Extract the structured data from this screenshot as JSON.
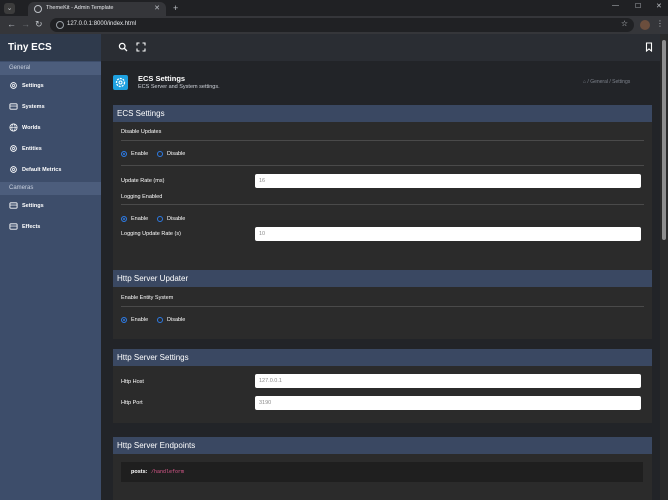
{
  "browser": {
    "tab_title": "ThemeKit - Admin Template",
    "url": "127.0.0.1:8000/index.html"
  },
  "sidebar": {
    "brand": "Tiny ECS",
    "sections": [
      {
        "label": "General"
      },
      {
        "label": "Cameras"
      }
    ],
    "general_items": [
      {
        "label": "Settings",
        "icon": "gear-icon"
      },
      {
        "label": "Systems",
        "icon": "monitor-icon"
      },
      {
        "label": "Worlds",
        "icon": "globe-icon"
      },
      {
        "label": "Entities",
        "icon": "gear-icon"
      },
      {
        "label": "Default Metrics",
        "icon": "gear-icon"
      }
    ],
    "camera_items": [
      {
        "label": "Settings",
        "icon": "monitor-icon"
      },
      {
        "label": "Effects",
        "icon": "monitor-icon"
      }
    ]
  },
  "header": {
    "title": "ECS Settings",
    "subtitle": "ECS Server and System settings.",
    "breadcrumb": [
      "General",
      "Settings"
    ]
  },
  "cards": {
    "ecs": {
      "title": "ECS Settings",
      "disable_updates_label": "Disable Updates",
      "enable_label": "Enable",
      "disable_label": "Disable",
      "update_rate_label": "Update Rate (ms)",
      "update_rate_value": "16",
      "logging_enabled_label": "Logging Enabled",
      "logging_update_rate_label": "Logging Update Rate (s)",
      "logging_update_rate_value": "10"
    },
    "updater": {
      "title": "Http Server Updater",
      "enable_entity_system_label": "Enable Entity System",
      "enable_label": "Enable",
      "disable_label": "Disable"
    },
    "server_settings": {
      "title": "Http Server Settings",
      "host_label": "Http Host",
      "host_value": "127.0.0.1",
      "port_label": "Http Port",
      "port_value": "3190"
    },
    "endpoints": {
      "title": "Http Server Endpoints",
      "key": "posts:",
      "value": "/handleform"
    }
  },
  "colors": {
    "sidebar": "#3d4d6a",
    "card_header": "#3a4862",
    "accent": "#2d7be5",
    "header_icon": "#1ea1e0",
    "code_value": "#e05a8f"
  }
}
